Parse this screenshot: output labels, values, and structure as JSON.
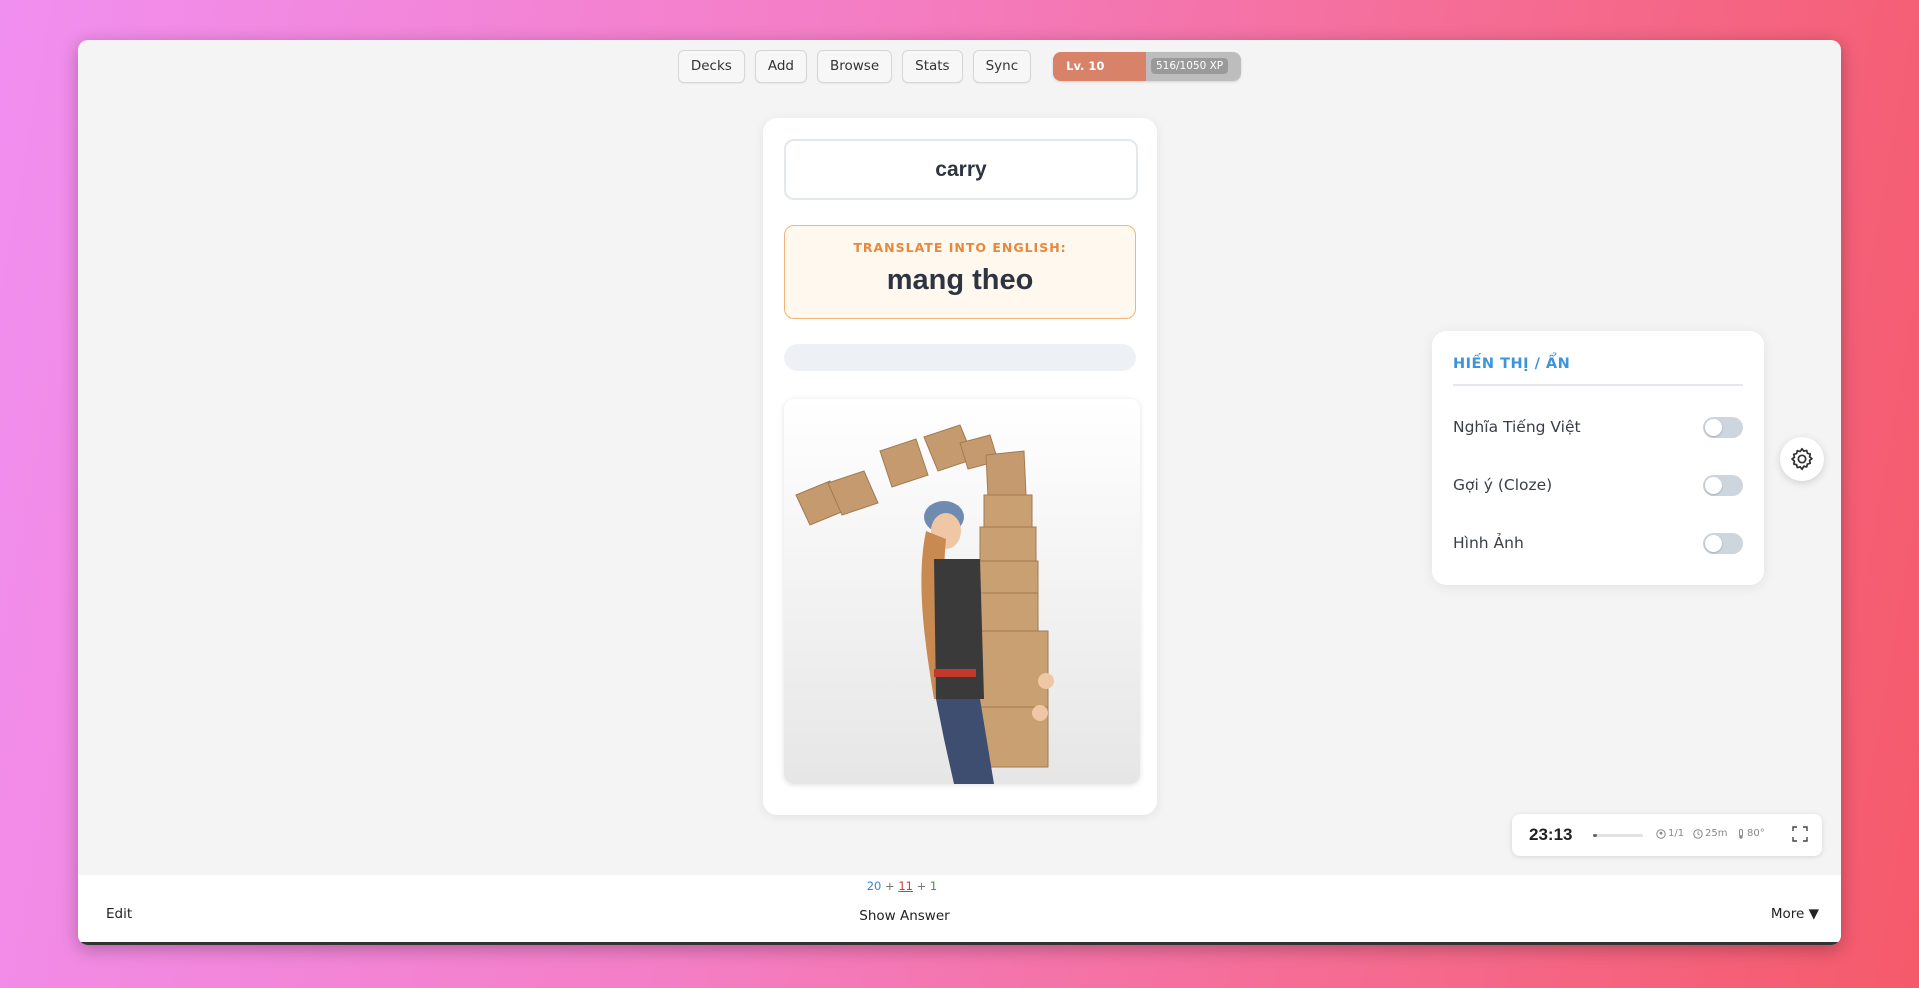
{
  "toolbar": {
    "decks_label": "Decks",
    "add_label": "Add",
    "browse_label": "Browse",
    "stats_label": "Stats",
    "sync_label": "Sync"
  },
  "xp": {
    "level": "Lv. 10",
    "text": "516/1050 XP",
    "current": 516,
    "max": 1050,
    "fill_color": "#d9826a"
  },
  "card": {
    "answer_value": "carry",
    "prompt_label": "TRANSLATE INTO ENGLISH:",
    "prompt_word": "mang theo",
    "image_icon": "photo-woman-carrying-boxes"
  },
  "panel": {
    "title": "HIẾN THỊ / ẨN",
    "rows": [
      {
        "label": "Nghĩa Tiếng Việt",
        "on": false
      },
      {
        "label": "Gợi ý (Cloze)",
        "on": false
      },
      {
        "label": "Hình Ảnh",
        "on": false
      }
    ]
  },
  "settings_icon": "gear-icon",
  "timer": {
    "time": "23:13",
    "progress": 0.08,
    "stat1": "1/1",
    "stat2": "25m",
    "stat3": "80°"
  },
  "bottom": {
    "count_new": "20",
    "count_learn": "11",
    "count_review": "1",
    "plus": "+",
    "edit_label": "Edit",
    "show_answer_label": "Show Answer",
    "more_label": "More ▼"
  },
  "colors": {
    "accent_blue": "#3b94dc",
    "accent_orange": "#e8883a"
  }
}
